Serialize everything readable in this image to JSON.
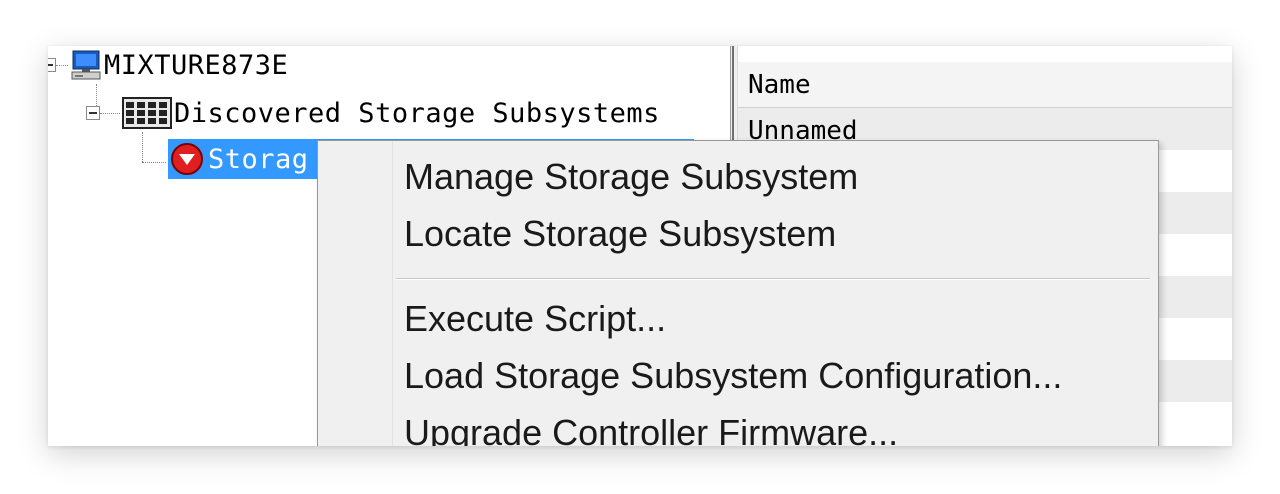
{
  "tree": {
    "root": {
      "label": "MIXTURE873E",
      "icon": "computer-icon"
    },
    "group": {
      "label": "Discovered Storage Subsystems",
      "icon": "storage-array-icon"
    },
    "item": {
      "label": "Storag",
      "icon": "warning-status-icon",
      "selected": true
    }
  },
  "list": {
    "header": "Name",
    "rows": [
      "Unnamed"
    ]
  },
  "context_menu": {
    "items": [
      "Manage Storage Subsystem",
      "Locate Storage Subsystem",
      "Execute Script...",
      "Load Storage Subsystem Configuration...",
      "Upgrade Controller Firmware..."
    ]
  },
  "colors": {
    "selection": "#3399ff",
    "menu_bg": "#f0f0f0",
    "status_red": "#e02020"
  }
}
